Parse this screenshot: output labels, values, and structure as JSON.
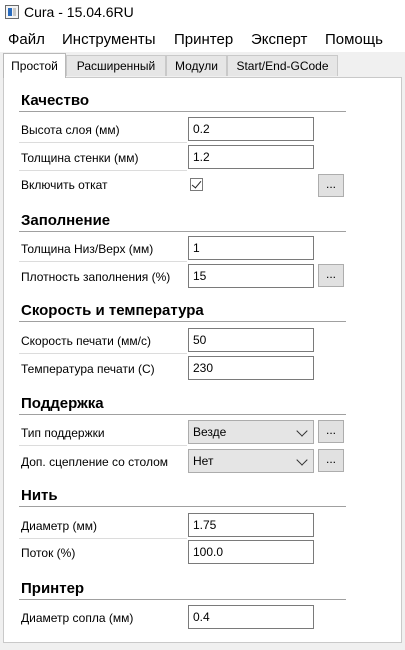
{
  "window": {
    "title": "Cura - 15.04.6RU"
  },
  "menu": [
    "Файл",
    "Инструменты",
    "Принтер",
    "Эксперт",
    "Помощь"
  ],
  "tabs": [
    "Простой",
    "Расширенный",
    "Модули",
    "Start/End-GCode"
  ],
  "active_tab": "Простой",
  "sections": {
    "quality": {
      "title": "Качество",
      "layer_height_label": "Высота слоя (мм)",
      "layer_height": "0.2",
      "wall_thickness_label": "Толщина стенки (мм)",
      "wall_thickness": "1.2",
      "retraction_label": "Включить откат",
      "retraction_checked": true
    },
    "fill": {
      "title": "Заполнение",
      "bottom_top_label": "Толщина Низ/Верх (мм)",
      "bottom_top": "1",
      "density_label": "Плотность заполнения (%)",
      "density": "15"
    },
    "speed": {
      "title": "Скорость и температура",
      "print_speed_label": "Скорость печати (мм/с)",
      "print_speed": "50",
      "print_temp_label": "Температура печати (С)",
      "print_temp": "230"
    },
    "support": {
      "title": "Поддержка",
      "support_type_label": "Тип поддержки",
      "support_type": "Везде",
      "adhesion_label": "Доп. сцепление со столом",
      "adhesion": "Нет"
    },
    "filament": {
      "title": "Нить",
      "diameter_label": "Диаметр (мм)",
      "diameter": "1.75",
      "flow_label": "Поток (%)",
      "flow": "100.0"
    },
    "machine": {
      "title": "Принтер",
      "nozzle_label": "Диаметр сопла (мм)",
      "nozzle": "0.4"
    }
  },
  "more_button_label": "..."
}
